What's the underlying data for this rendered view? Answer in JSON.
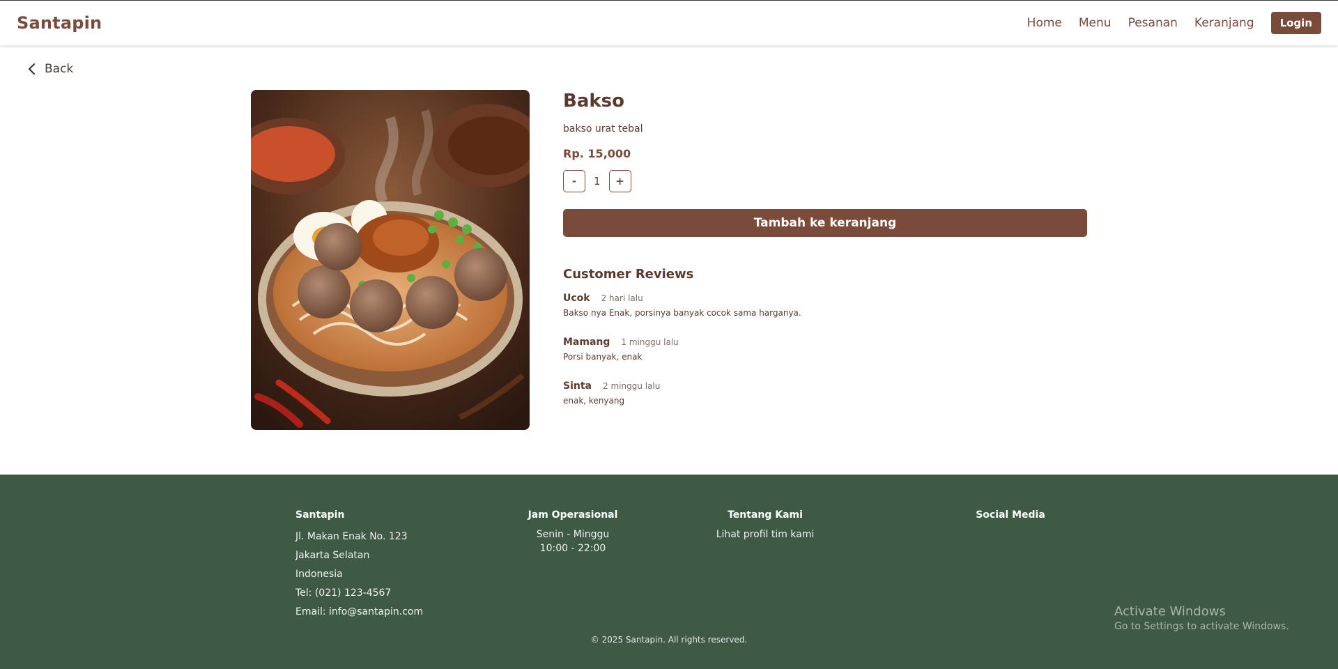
{
  "header": {
    "brand": "Santapin",
    "nav": [
      "Home",
      "Menu",
      "Pesanan",
      "Keranjang"
    ],
    "login": "Login"
  },
  "back_label": "Back",
  "product": {
    "name": "Bakso",
    "description": "bakso urat tebal",
    "price": "Rp. 15,000",
    "quantity": "1",
    "minus_label": "-",
    "plus_label": "+",
    "add_to_cart": "Tambah ke keranjang"
  },
  "reviews": {
    "title": "Customer Reviews",
    "items": [
      {
        "name": "Ucok",
        "time": "2 hari lalu",
        "text": "Bakso nya Enak, porsinya banyak cocok sama harganya."
      },
      {
        "name": "Mamang",
        "time": "1 minggu lalu",
        "text": "Porsi banyak, enak"
      },
      {
        "name": "Sinta",
        "time": "2 minggu lalu",
        "text": "enak, kenyang"
      }
    ]
  },
  "footer": {
    "col1": {
      "title": "Santapin",
      "lines": [
        "Jl. Makan Enak No. 123",
        "Jakarta Selatan",
        "Indonesia",
        "Tel: (021) 123-4567",
        "Email: info@santapin.com"
      ]
    },
    "col2": {
      "title": "Jam Operasional",
      "lines": [
        "Senin - Minggu",
        "10:00 - 22:00"
      ]
    },
    "col3": {
      "title": "Tentang Kami",
      "link": "Lihat profil tim kami"
    },
    "col4": {
      "title": "Social Media"
    },
    "copyright": "© 2025 Santapin. All rights reserved."
  },
  "watermark": {
    "line1": "Activate Windows",
    "line2": "Go to Settings to activate Windows."
  },
  "colors": {
    "brand": "#7a4a3a",
    "footer_bg": "#3e5a45"
  }
}
